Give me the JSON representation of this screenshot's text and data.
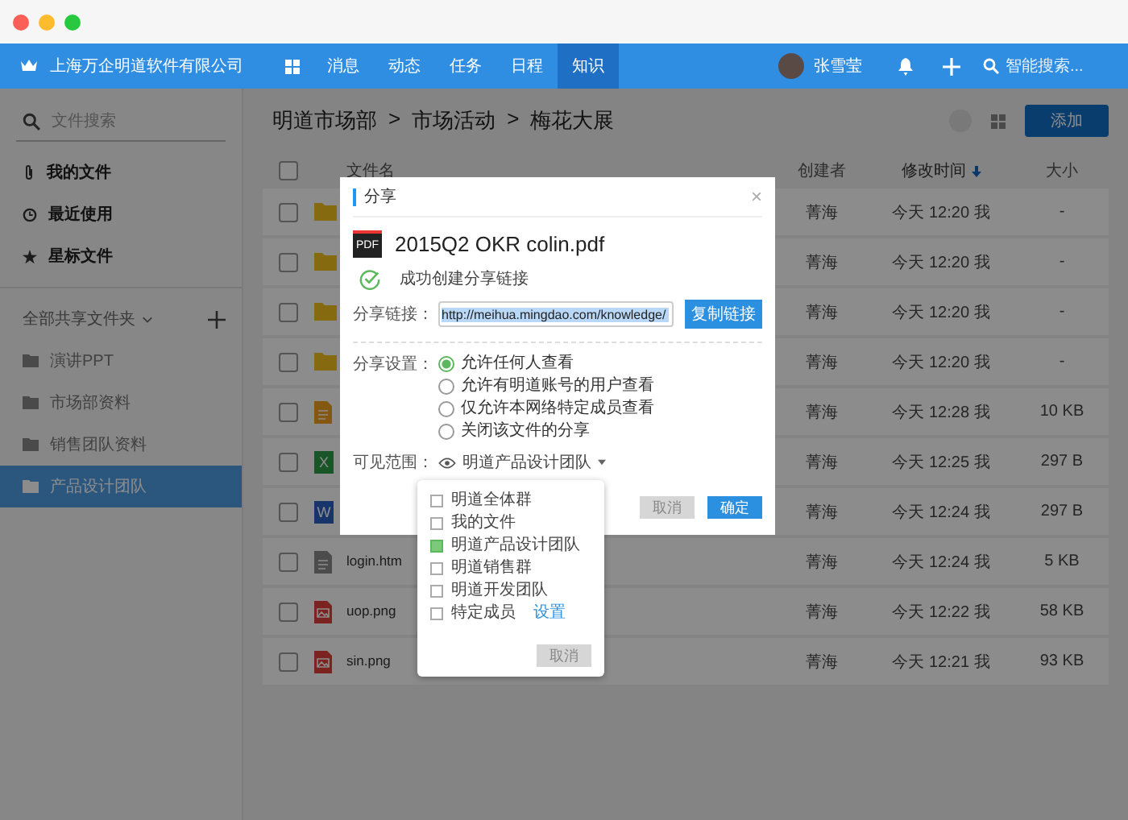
{
  "nav": {
    "company": "上海万企明道软件有限公司",
    "tabs": [
      {
        "label": "消息",
        "selected": false
      },
      {
        "label": "动态",
        "selected": false
      },
      {
        "label": "任务",
        "selected": false
      },
      {
        "label": "日程",
        "selected": false
      },
      {
        "label": "知识",
        "selected": true
      }
    ],
    "user": "张雪莹",
    "search": {
      "placeholder": "智能搜索..."
    }
  },
  "sidebar": {
    "search": {
      "placeholder": "文件搜索"
    },
    "items": [
      {
        "label": "我的文件",
        "kind": "clip"
      },
      {
        "label": "最近使用",
        "kind": "clock"
      },
      {
        "label": "星标文件",
        "kind": "star"
      }
    ],
    "shared_heading": "全部共享文件夹",
    "folders": [
      {
        "label": "演讲PPT",
        "selected": false
      },
      {
        "label": "市场部资料",
        "selected": false
      },
      {
        "label": "销售团队资料",
        "selected": false
      },
      {
        "label": "产品设计团队",
        "selected": true
      }
    ]
  },
  "breadcrumb": {
    "items": [
      "明道市场部",
      "市场活动",
      "梅花大展"
    ],
    "separator": ">"
  },
  "add_button": "添加",
  "table": {
    "select_all": {
      "checked": false
    },
    "columns": [
      {
        "label": "文件名",
        "sorted": false
      },
      {
        "label": "创建者",
        "sorted": false
      },
      {
        "label": "修改时间",
        "sorted": true
      },
      {
        "label": "大小",
        "sorted": false
      }
    ],
    "rows": [
      {
        "kind": "folder",
        "checked": false,
        "creator": "菁海",
        "modified": "今天 12:20 我",
        "size": "-"
      },
      {
        "kind": "folder",
        "checked": false,
        "creator": "菁海",
        "modified": "今天 12:20 我",
        "size": "-"
      },
      {
        "kind": "folder",
        "checked": false,
        "creator": "菁海",
        "modified": "今天 12:20 我",
        "size": "-"
      },
      {
        "kind": "folder",
        "checked": false,
        "creator": "菁海",
        "modified": "今天 12:20 我",
        "size": "-"
      },
      {
        "kind": "archive",
        "checked": false,
        "creator": "菁海",
        "modified": "今天 12:28 我",
        "size": "10 KB"
      },
      {
        "kind": "sheet",
        "badge": "X",
        "checked": false,
        "creator": "菁海",
        "modified": "今天 12:25 我",
        "size": "297 B"
      },
      {
        "kind": "word",
        "badge": "W",
        "checked": false,
        "creator": "菁海",
        "modified": "今天 12:24 我",
        "size": "297 B"
      },
      {
        "kind": "doc",
        "name": "login.htm",
        "checked": false,
        "creator": "菁海",
        "modified": "今天 12:24 我",
        "size": "5 KB"
      },
      {
        "kind": "image",
        "name": "uop.png",
        "checked": false,
        "creator": "菁海",
        "modified": "今天 12:22 我",
        "size": "58 KB"
      },
      {
        "kind": "image",
        "name": "sin.png",
        "checked": false,
        "creator": "菁海",
        "modified": "今天 12:21 我",
        "size": "93 KB"
      }
    ]
  },
  "modal": {
    "title": "分享",
    "close": "×",
    "file_badge": "PDF",
    "file": "2015Q2 OKR colin.pdf",
    "success": "成功创建分享链接",
    "link_label": "分享链接：",
    "link": "http://meihua.mingdao.com/knowledge/",
    "copy_button": "复制链接",
    "settings_label": "分享设置：",
    "options": [
      {
        "label": "允许任何人查看",
        "selected": true
      },
      {
        "label": "允许有明道账号的用户查看",
        "selected": false
      },
      {
        "label": "仅允许本网络特定成员查看",
        "selected": false
      },
      {
        "label": "关闭该文件的分享",
        "selected": false
      }
    ],
    "scope_label": "可见范围：",
    "scope_value": "明道产品设计团队",
    "cancel": "取消",
    "confirm": "确定"
  },
  "dropdown": {
    "items": [
      {
        "label": "明道全体群",
        "checked": false
      },
      {
        "label": "我的文件",
        "checked": false
      },
      {
        "label": "明道产品设计团队",
        "checked": true
      },
      {
        "label": "明道销售群",
        "checked": false
      },
      {
        "label": "明道开发团队",
        "checked": false
      },
      {
        "label": "特定成员",
        "checked": false,
        "link": "设置"
      }
    ],
    "cancel": "取消"
  }
}
